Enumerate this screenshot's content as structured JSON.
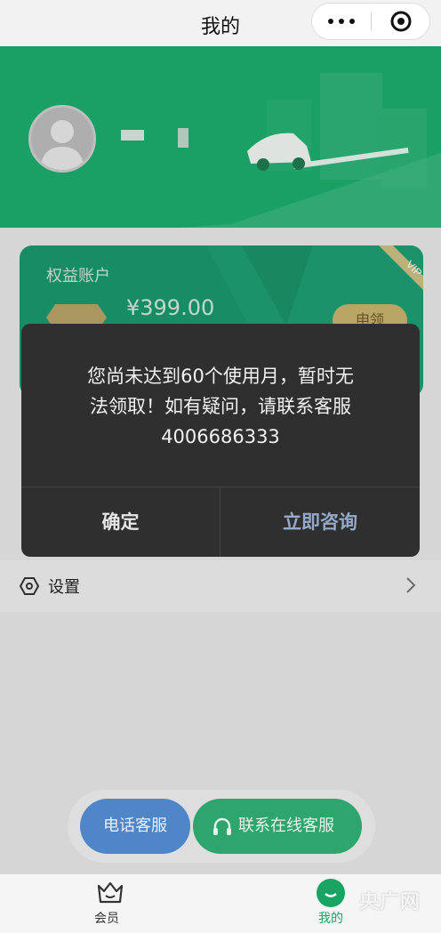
{
  "nav": {
    "title": "我的"
  },
  "card": {
    "title": "权益账户",
    "amount": "¥399.00",
    "claim_label": "申领"
  },
  "settings": {
    "label": "设置"
  },
  "dialog": {
    "line1": "您尚未达到60个使用月，暂时无",
    "line2": "法领取！如有疑问，请联系客服",
    "line3": "4006686333",
    "confirm_label": "确定",
    "consult_label": "立即咨询"
  },
  "service": {
    "phone_label": "电话客服",
    "online_label": "联系在线客服"
  },
  "tabs": [
    {
      "label": "会员",
      "icon": "crown-icon"
    },
    {
      "label": "我的",
      "icon": "smile-icon",
      "active": true
    }
  ],
  "watermark": "央广网",
  "colors": {
    "brand_green": "#1dad6d",
    "dialog_bg": "#2f2f2f",
    "phone_btn": "#4f86c8",
    "online_btn": "#2ea56d"
  }
}
